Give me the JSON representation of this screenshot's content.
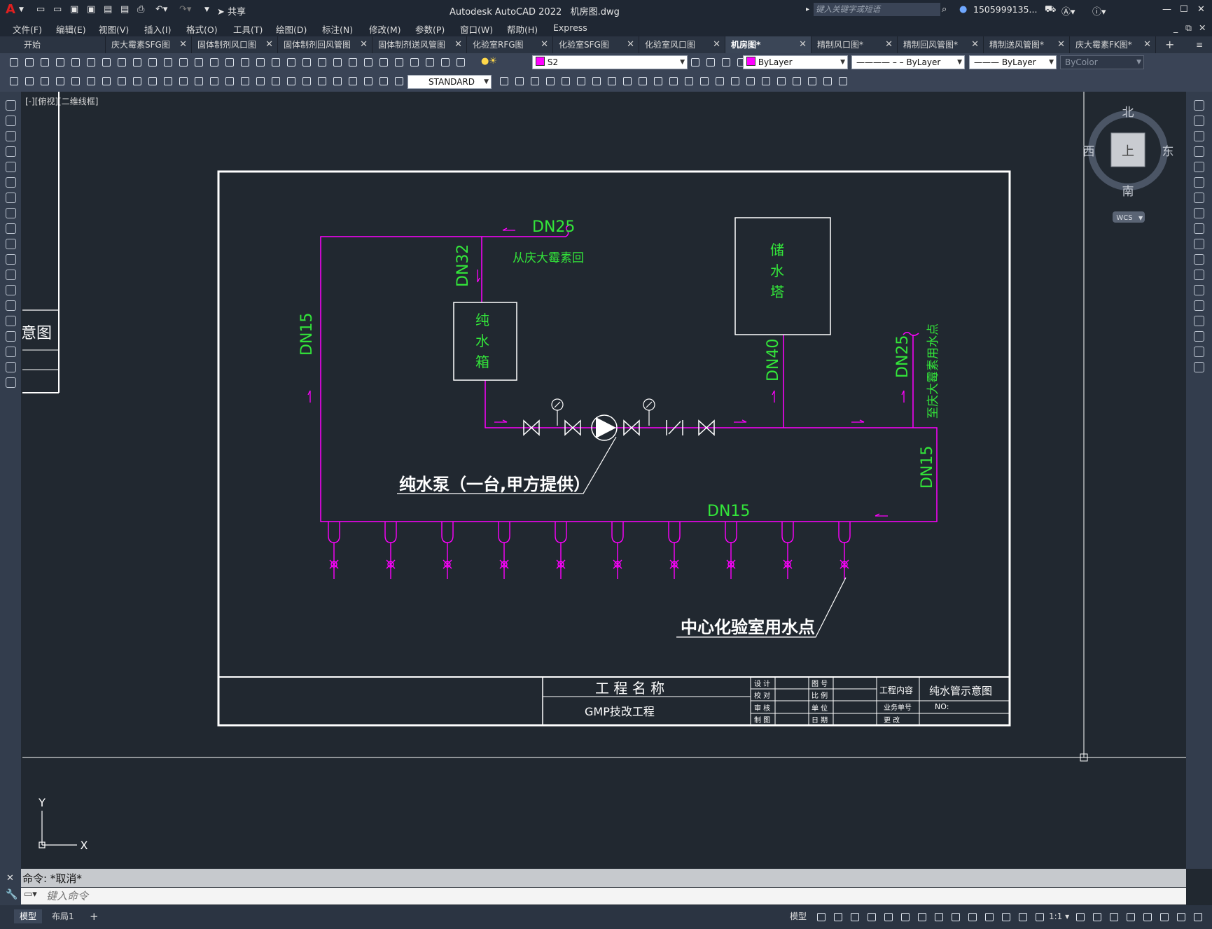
{
  "app": {
    "title": "Autodesk AutoCAD 2022",
    "filename": "机房图.dwg",
    "search_placeholder": "键入关键字或短语",
    "user": "1505999135...",
    "share": "共享"
  },
  "menu": [
    "文件(F)",
    "编辑(E)",
    "视图(V)",
    "插入(I)",
    "格式(O)",
    "工具(T)",
    "绘图(D)",
    "标注(N)",
    "修改(M)",
    "参数(P)",
    "窗口(W)",
    "帮助(H)",
    "Express"
  ],
  "tabs": [
    {
      "label": "开始",
      "closable": false
    },
    {
      "label": "庆大霉素SFG图",
      "closable": true
    },
    {
      "label": "固体制剂风口图",
      "closable": true
    },
    {
      "label": "固体制剂回风管图",
      "closable": true
    },
    {
      "label": "固体制剂送风管图",
      "closable": true
    },
    {
      "label": "化验室RFG图",
      "closable": true
    },
    {
      "label": "化验室SFG图",
      "closable": true
    },
    {
      "label": "化验室风口图",
      "closable": true
    },
    {
      "label": "机房图*",
      "closable": true,
      "active": true
    },
    {
      "label": "精制风口图*",
      "closable": true
    },
    {
      "label": "精制回风管图*",
      "closable": true
    },
    {
      "label": "精制送风管图*",
      "closable": true
    },
    {
      "label": "庆大霉素FK图*",
      "closable": true
    }
  ],
  "properties": {
    "layer": "S2",
    "layer_color": "#ff00ff",
    "color": "ByLayer",
    "linetype": "ByLayer",
    "lineweight": "ByLayer",
    "plotstyle": "ByColor",
    "textstyle": "STANDARD"
  },
  "viewport": {
    "label": "[-][俯视][二维线框]",
    "partial_title": "意图"
  },
  "viewcube": {
    "north": "北",
    "south": "南",
    "east": "东",
    "west": "西",
    "face": "上",
    "ucs": "WCS"
  },
  "ucs_axes": {
    "x": "X",
    "y": "Y"
  },
  "drawing": {
    "pipe_labels": {
      "top": "DN25",
      "from_note": "从庆大霉素回",
      "dn32": "DN32",
      "left": "DN15",
      "dn40": "DN40",
      "right_dn25": "DN25",
      "to_note": "至庆大霉素用水点",
      "right_dn15": "DN15",
      "bottom": "DN15"
    },
    "tank1": [
      "纯",
      "水",
      "箱"
    ],
    "tank2": [
      "储",
      "水",
      "塔"
    ],
    "pump_note": "纯水泵（一台,甲方提供）",
    "points_note": "中心化验室用水点",
    "outlet_count": 10
  },
  "titleblock": {
    "project_name_label": "工 程 名 称",
    "project_name": "GMP技改工程",
    "design": "设 计",
    "check": "校 对",
    "review": "审 核",
    "draw": "制 图",
    "drawing_no": "图 号",
    "scale": "比 例",
    "unit": "单 位",
    "date": "日 期",
    "content_label": "工程内容",
    "content": "纯水管示意图",
    "job_no_label": "业务单号",
    "job_no": "NO:",
    "revise": "更 改"
  },
  "command": {
    "history": "命令: *取消*",
    "placeholder": "键入命令"
  },
  "status": {
    "model": "模型",
    "layout": "布局1",
    "add": "+",
    "model_space": "模型",
    "scale": "1:1"
  }
}
